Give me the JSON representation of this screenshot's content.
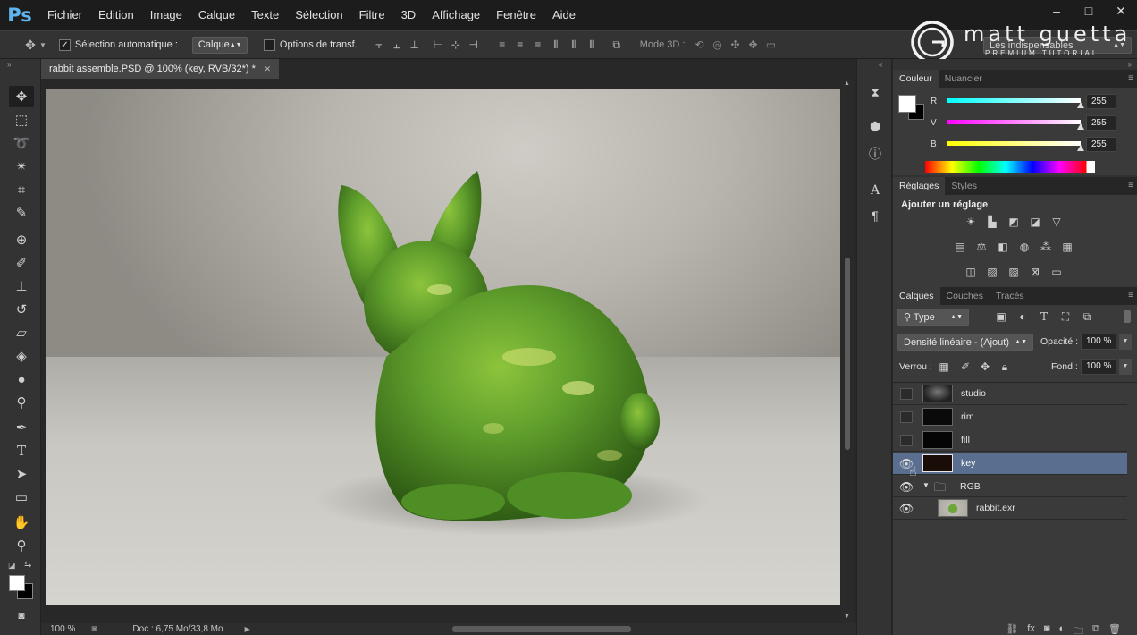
{
  "app": {
    "logo": "Ps"
  },
  "menu": [
    "Fichier",
    "Edition",
    "Image",
    "Calque",
    "Texte",
    "Sélection",
    "Filtre",
    "3D",
    "Affichage",
    "Fenêtre",
    "Aide"
  ],
  "window_controls": {
    "minimize": "–",
    "maximize": "□",
    "close": "✕"
  },
  "options": {
    "auto_select_label": "Sélection automatique :",
    "auto_select_checked": true,
    "auto_select_target": "Calque",
    "transform_label": "Options de transf.",
    "mode3d_label": "Mode 3D :",
    "workspace": "Les indispensables"
  },
  "watermark": {
    "name": "matt guetta",
    "tagline": "PREMIUM TUTORIAL"
  },
  "document": {
    "tab_title": "rabbit assemble.PSD @ 100% (key, RVB/32*) *",
    "close": "✕",
    "zoom": "100 %",
    "doc_info": "Doc : 6,75 Mo/33,8 Mo"
  },
  "color_panel": {
    "tabs": [
      "Couleur",
      "Nuancier"
    ],
    "channels": [
      {
        "label": "R",
        "value": "255"
      },
      {
        "label": "V",
        "value": "255"
      },
      {
        "label": "B",
        "value": "255"
      }
    ]
  },
  "adjustments_panel": {
    "tabs": [
      "Réglages",
      "Styles"
    ],
    "heading": "Ajouter un réglage"
  },
  "layers_panel": {
    "tabs": [
      "Calques",
      "Couches",
      "Tracés"
    ],
    "filter": "Type",
    "blend_mode": "Densité linéaire - (Ajout)",
    "opacity_label": "Opacité :",
    "opacity": "100 %",
    "lock_label": "Verrou :",
    "fill_label": "Fond :",
    "fill": "100 %",
    "layers": [
      {
        "name": "studio",
        "visible": false
      },
      {
        "name": "rim",
        "visible": false
      },
      {
        "name": "fill",
        "visible": false
      },
      {
        "name": "key",
        "visible": true,
        "selected": true
      },
      {
        "name": "RGB",
        "visible": true,
        "group": true
      },
      {
        "name": "rabbit.exr",
        "visible": true
      }
    ]
  },
  "colors": {
    "accent": "#5fb3ef",
    "selected_layer": "#5a6f8f",
    "rabbit_green": "#5f9e2c"
  }
}
